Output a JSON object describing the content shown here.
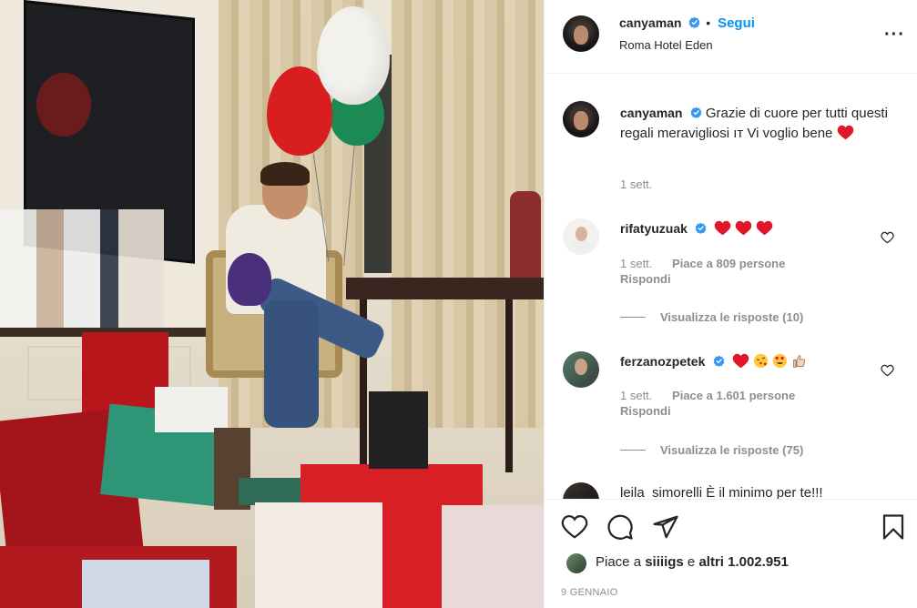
{
  "post": {
    "author": "canyaman",
    "follow_label": "Segui",
    "separator": "•",
    "location": "Roma Hotel Eden",
    "more_options_icon": "ellipsis-icon"
  },
  "caption": {
    "username": "canyaman",
    "text": "Grazie di cuore per tutti questi regali meravigliosi ıт Vi voglio bene",
    "emoji": "red-heart",
    "time": "1 sett."
  },
  "comments": [
    {
      "username": "rifatyuzuak",
      "emojis": [
        "red-heart",
        "red-heart",
        "red-heart"
      ],
      "time": "1 sett.",
      "likes": "Piace a 809 persone",
      "reply": "Rispondi",
      "view_replies": "Visualizza le risposte (10)"
    },
    {
      "username": "ferzanozpetek",
      "emojis": [
        "red-heart",
        "kiss-face",
        "heart-eyes-face",
        "thumbs-up"
      ],
      "time": "1 sett.",
      "likes": "Piace a 1.601 persone",
      "reply": "Rispondi",
      "view_replies": "Visualizza le risposte (75)"
    }
  ],
  "partial_comment": {
    "text": "leila_simorelli È il minimo per te!!!"
  },
  "actions": {
    "like_icon": "heart-outline-icon",
    "comment_icon": "comment-icon",
    "share_icon": "paper-plane-icon",
    "save_icon": "bookmark-icon"
  },
  "likes": {
    "prefix": "Piace a",
    "user": "siiiigs",
    "middle": "e",
    "rest": "altri 1.002.951"
  },
  "date": "9 GENNAIO",
  "colors": {
    "link": "#0095f6",
    "heart": "#ed4956",
    "muted": "#8e8e8e",
    "text": "#262626"
  }
}
